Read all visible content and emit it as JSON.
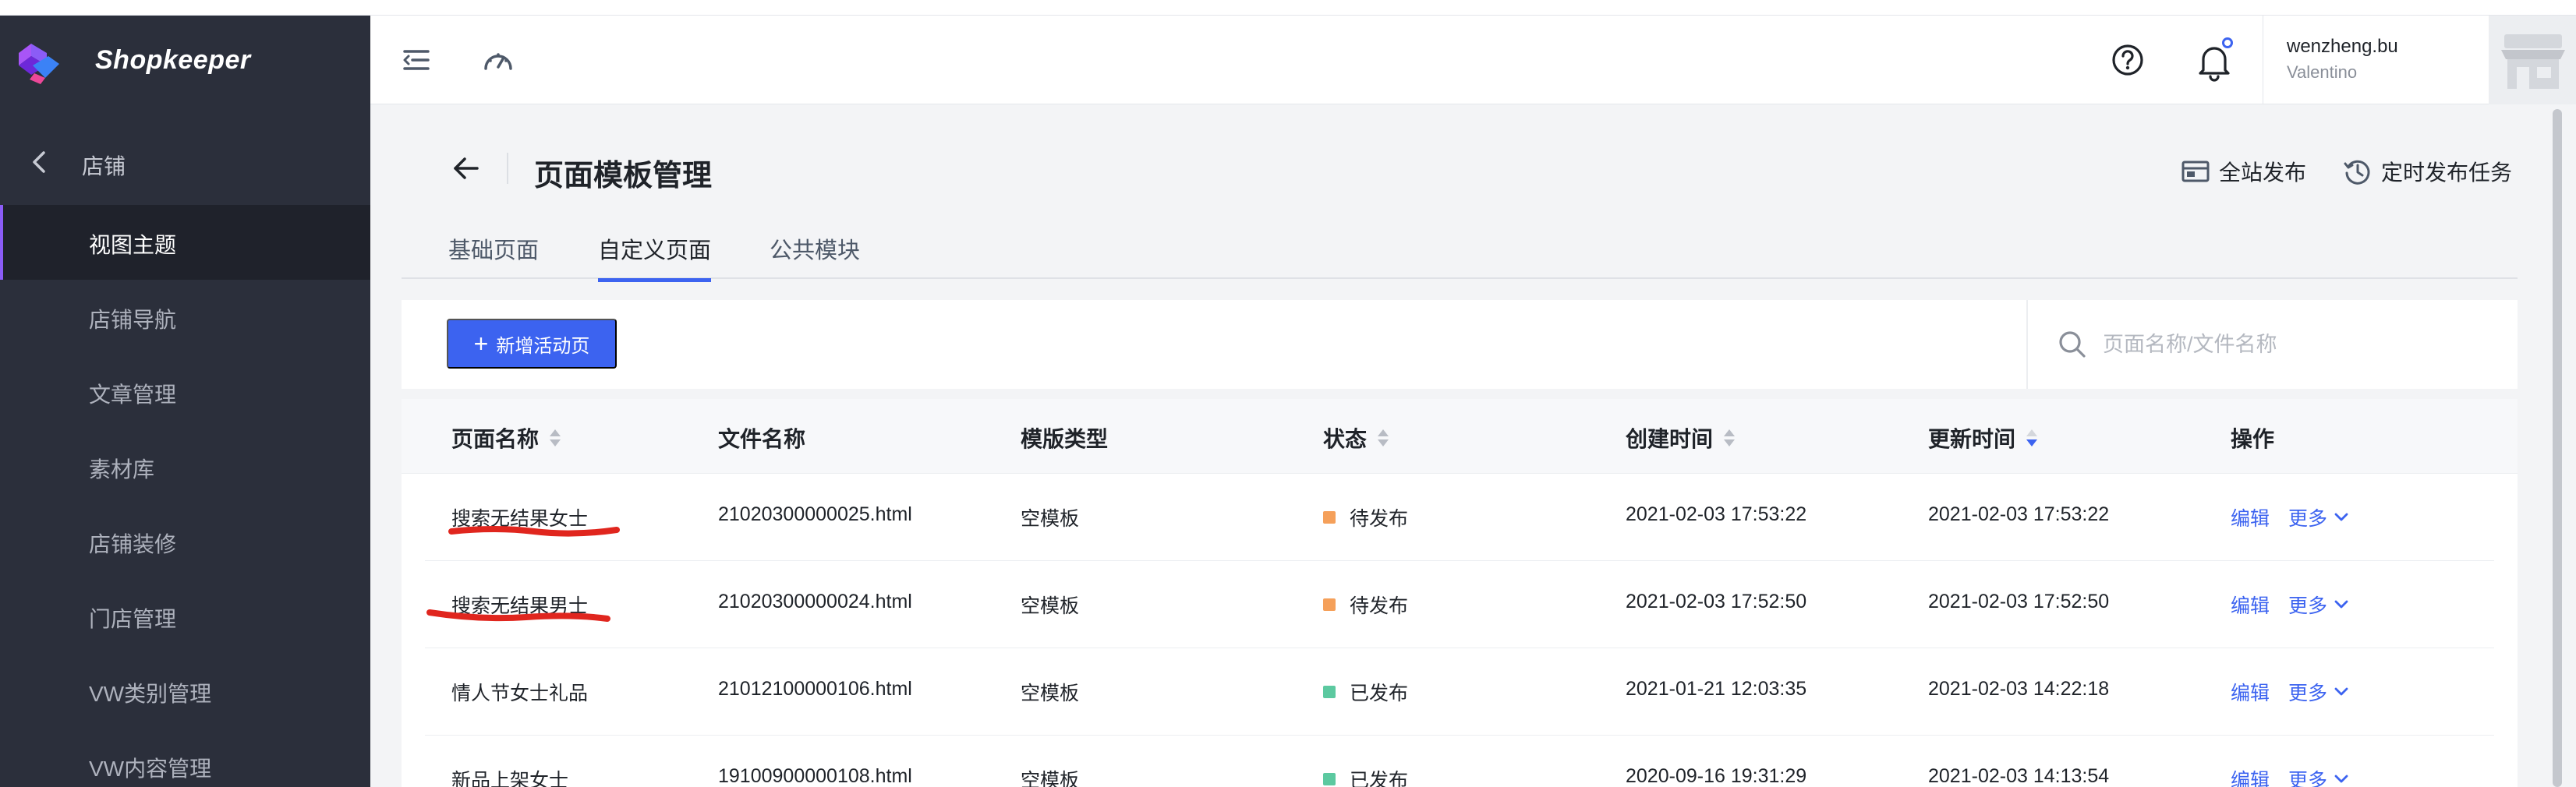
{
  "app": {
    "name": "Shopkeeper"
  },
  "sidebar": {
    "back_label": "店铺",
    "items": [
      {
        "label": "视图主题",
        "active": true
      },
      {
        "label": "店铺导航"
      },
      {
        "label": "文章管理"
      },
      {
        "label": "素材库"
      },
      {
        "label": "店铺装修"
      },
      {
        "label": "门店管理"
      },
      {
        "label": "VW类别管理"
      },
      {
        "label": "VW内容管理"
      }
    ]
  },
  "topbar": {
    "icons": [
      "menu-collapse-icon",
      "dashboard-icon",
      "help-icon",
      "bell-icon"
    ],
    "user": {
      "name": "wenzheng.bu",
      "org": "Valentino"
    },
    "notification_dot": true
  },
  "page": {
    "title": "页面模板管理",
    "actions": {
      "publish_all": "全站发布",
      "scheduled": "定时发布任务"
    },
    "tabs": [
      {
        "label": "基础页面"
      },
      {
        "label": "自定义页面",
        "active": true
      },
      {
        "label": "公共模块"
      }
    ]
  },
  "toolbar": {
    "add_label": "新增活动页",
    "search_placeholder": "页面名称/文件名称"
  },
  "table": {
    "headers": {
      "name": "页面名称",
      "file": "文件名称",
      "type": "模版类型",
      "status": "状态",
      "created": "创建时间",
      "updated": "更新时间",
      "ops": "操作"
    },
    "edit_label": "编辑",
    "more_label": "更多",
    "rows": [
      {
        "name": "搜索无结果女士",
        "file": "21020300000025.html",
        "type": "空模板",
        "status": "待发布",
        "created": "2021-02-03 17:53:22",
        "updated": "2021-02-03 17:53:22"
      },
      {
        "name": "搜索无结果男士",
        "file": "21020300000024.html",
        "type": "空模板",
        "status": "待发布",
        "created": "2021-02-03 17:52:50",
        "updated": "2021-02-03 17:52:50"
      },
      {
        "name": "情人节女士礼品",
        "file": "21012100000106.html",
        "type": "空模板",
        "status": "已发布",
        "created": "2021-01-21 12:03:35",
        "updated": "2021-02-03 14:22:18"
      },
      {
        "name": "新品上架女士",
        "file": "19100900000108.html",
        "type": "空模板",
        "status": "已发布",
        "created": "2020-09-16 19:31:29",
        "updated": "2021-02-03 14:13:54"
      }
    ]
  },
  "colors": {
    "sidebar_bg": "#2b2f3b",
    "accent": "#3c63f0",
    "pending": "#f5a05a",
    "published": "#5cc9a0",
    "annotation": "#e0261e"
  }
}
